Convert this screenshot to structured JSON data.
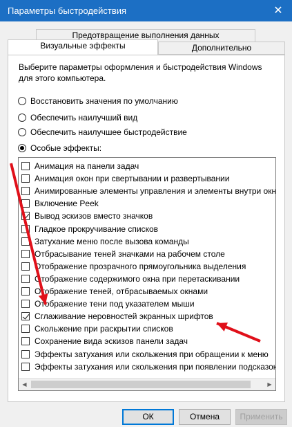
{
  "window": {
    "title": "Параметры быстродействия",
    "close_glyph": "✕"
  },
  "tabs": [
    {
      "label": "Предотвращение выполнения данных"
    },
    {
      "label": "Визуальные эффекты"
    },
    {
      "label": "Дополнительно"
    }
  ],
  "description": "Выберите параметры оформления и быстродействия Windows для этого компьютера.",
  "radios": [
    {
      "label": "Восстановить значения по умолчанию",
      "selected": false
    },
    {
      "label": "Обеспечить наилучший вид",
      "selected": false
    },
    {
      "label": "Обеспечить наилучшее быстродействие",
      "selected": false
    },
    {
      "label": "Особые эффекты:",
      "selected": true
    }
  ],
  "effects": [
    {
      "label": "Анимация на панели задач",
      "checked": false
    },
    {
      "label": "Анимация окон при свертывании и развертывании",
      "checked": false
    },
    {
      "label": "Анимированные элементы управления и элементы внутри окна",
      "checked": false
    },
    {
      "label": "Включение Peek",
      "checked": false
    },
    {
      "label": "Вывод эскизов вместо значков",
      "checked": true
    },
    {
      "label": "Гладкое прокручивание списков",
      "checked": false
    },
    {
      "label": "Затухание меню после вызова команды",
      "checked": false
    },
    {
      "label": "Отбрасывание теней значками на рабочем столе",
      "checked": false
    },
    {
      "label": "Отображение прозрачного прямоугольника выделения",
      "checked": false
    },
    {
      "label": "Отображение содержимого окна при перетаскивании",
      "checked": false
    },
    {
      "label": "Отображение теней, отбрасываемых окнами",
      "checked": false
    },
    {
      "label": "Отображение тени под указателем мыши",
      "checked": false
    },
    {
      "label": "Сглаживание неровностей экранных шрифтов",
      "checked": true
    },
    {
      "label": "Скольжение при раскрытии списков",
      "checked": false
    },
    {
      "label": "Сохранение вида эскизов панели задач",
      "checked": false
    },
    {
      "label": "Эффекты затухания или скольжения при обращении к меню",
      "checked": false
    },
    {
      "label": "Эффекты затухания или скольжения при появлении подсказок",
      "checked": false
    }
  ],
  "scroll": {
    "left_icon": "◀",
    "right_icon": "▶"
  },
  "buttons": {
    "ok": "ОК",
    "cancel": "Отмена",
    "apply": "Применить"
  },
  "annotation_color": "#e0101a"
}
